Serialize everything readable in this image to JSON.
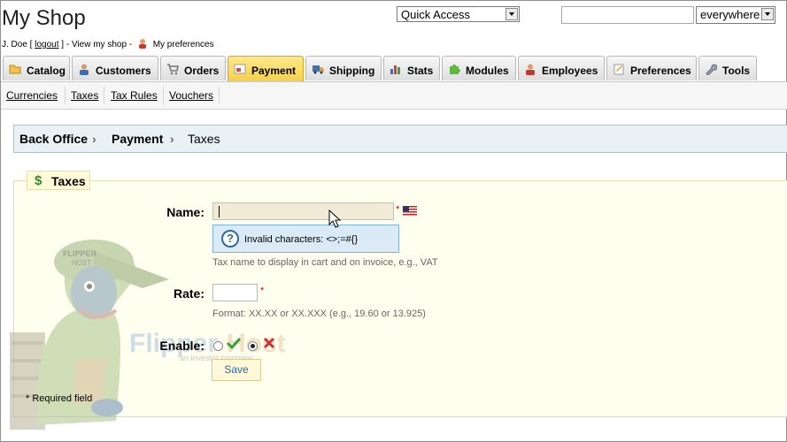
{
  "header": {
    "shop_title": "My Shop",
    "user_prefix": "J. Doe [",
    "logout_label": "logout",
    "user_mid": "] - View my shop -",
    "preferences_label": "My preferences"
  },
  "quick_access": {
    "selected": "Quick Access"
  },
  "search": {
    "value": "",
    "scope_selected": "everywhere"
  },
  "tabs": [
    {
      "label": "Catalog",
      "icon": "folder-icon"
    },
    {
      "label": "Customers",
      "icon": "user-icon"
    },
    {
      "label": "Orders",
      "icon": "cart-icon"
    },
    {
      "label": "Payment",
      "icon": "payment-icon",
      "active": true
    },
    {
      "label": "Shipping",
      "icon": "truck-icon"
    },
    {
      "label": "Stats",
      "icon": "bar-chart-icon"
    },
    {
      "label": "Modules",
      "icon": "puzzle-icon"
    },
    {
      "label": "Employees",
      "icon": "employee-icon"
    },
    {
      "label": "Preferences",
      "icon": "preferences-icon"
    },
    {
      "label": "Tools",
      "icon": "wrench-icon"
    }
  ],
  "subtabs": [
    "Currencies",
    "Taxes",
    "Tax Rules",
    "Vouchers"
  ],
  "breadcrumb": [
    "Back Office",
    "Payment",
    "Taxes"
  ],
  "form": {
    "legend": "Taxes",
    "name_label": "Name:",
    "name_value": "",
    "required_mark": "*",
    "hint_text": "Invalid characters: <>;=#{}",
    "name_help": "Tax name to display in cart and on invoice, e.g., VAT",
    "rate_label": "Rate:",
    "rate_value": "",
    "rate_help": "Format: XX.XX or XX.XXX (e.g., 19.60 or 13.925)",
    "enable_label": "Enable:",
    "enable_selected": "no",
    "save_label": "Save",
    "required_note": "* Required field"
  },
  "watermark": {
    "brand": "FlipperHost",
    "tagline": "an investor company"
  },
  "colors": {
    "active_tab": "#f6cf4a",
    "breadcrumb_bg": "#eaf1f5",
    "fieldset_bg": "#fffff0",
    "link_blue": "#2c6aa0"
  }
}
